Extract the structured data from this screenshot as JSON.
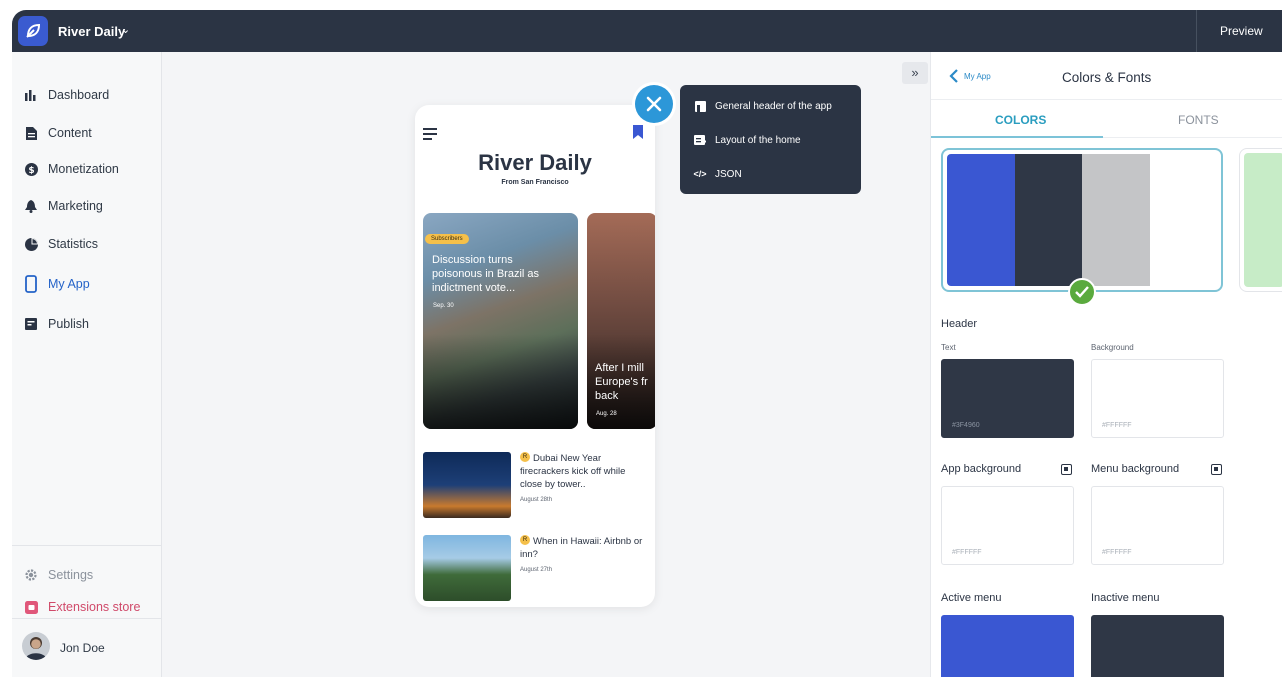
{
  "topbar": {
    "app_name": "River Daily",
    "caret": "⌄",
    "preview_label": "Preview"
  },
  "sidebar": {
    "items": [
      {
        "label": "Dashboard",
        "icon": "bar-chart-icon"
      },
      {
        "label": "Content",
        "icon": "document-icon"
      },
      {
        "label": "Monetization",
        "icon": "dollar-circle-icon"
      },
      {
        "label": "Marketing",
        "icon": "bell-icon"
      },
      {
        "label": "Statistics",
        "icon": "pie-chart-icon"
      },
      {
        "label": "My App",
        "icon": "phone-icon",
        "active": true
      },
      {
        "label": "Publish",
        "icon": "publish-icon"
      }
    ],
    "settings_label": "Settings",
    "extensions_label": "Extensions store",
    "user_name": "Jon Doe"
  },
  "phone": {
    "title": "River Daily",
    "subtitle": "From San Francisco",
    "cards": [
      {
        "badge": "Subscribers",
        "title": "Discussion turns poisonous in Brazil as indictment vote...",
        "date": "Sep. 30"
      },
      {
        "title": "After I mill Europe's fr back",
        "date": "Aug. 28"
      }
    ],
    "list": [
      {
        "badge": "R",
        "title": "Dubai New Year firecrackers kick off while close by tower..",
        "date": "August 28th"
      },
      {
        "badge": "R",
        "title": "When in Hawaii: Airbnb or inn?",
        "date": "August 27th"
      }
    ]
  },
  "popup_menu": {
    "items": [
      {
        "label": "General header of the app",
        "icon": "header-icon"
      },
      {
        "label": "Layout of the home",
        "icon": "layout-icon"
      },
      {
        "label": "JSON",
        "icon": "code-icon",
        "glyph": "</>"
      }
    ]
  },
  "collapse_label": "»",
  "panel": {
    "back_label": "My App",
    "title": "Colors & Fonts",
    "tabs": [
      "COLORS",
      "FONTS"
    ],
    "active_tab": "COLORS",
    "palette": [
      "#3a57d2",
      "#2f3746",
      "#c4c5c7",
      "#ffffff"
    ],
    "palette_alt": "#c7ecc7",
    "header_section": "Header",
    "header_text_label": "Text",
    "header_text_hex": "#3F4960",
    "header_bg_label": "Background",
    "header_bg_hex": "#FFFFFF",
    "app_bg_label": "App background",
    "app_bg_hex": "#FFFFFF",
    "menu_bg_label": "Menu background",
    "menu_bg_hex": "#FFFFFF",
    "active_menu_label": "Active menu",
    "active_menu_color": "#3a57d2",
    "inactive_menu_label": "Inactive menu",
    "inactive_menu_color": "#2f3746"
  }
}
